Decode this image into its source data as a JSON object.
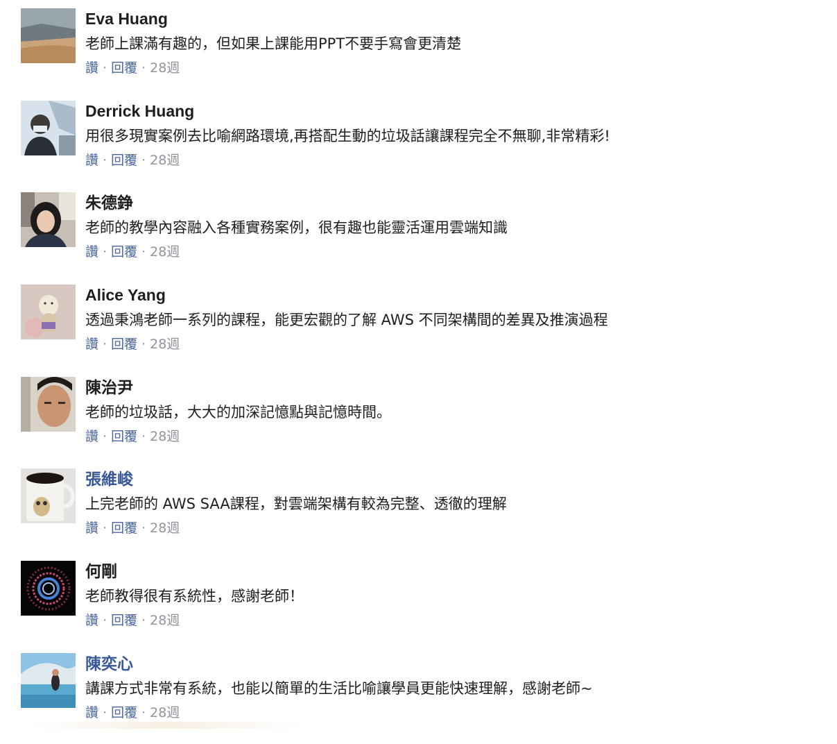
{
  "comments": [
    {
      "name": "Eva Huang",
      "text": "老師上課滿有趣的，但如果上課能用PPT不要手寫會更清楚",
      "like": "讚",
      "reply": "回覆",
      "sep": "·",
      "time": "28週",
      "name_is_link": false,
      "avatar_icon": "avatar-photo-beach"
    },
    {
      "name": "Derrick Huang",
      "text": "用很多現實案例去比喻網路環境,再搭配生動的垃圾話讓課程完全不無聊,非常精彩!",
      "like": "讚",
      "reply": "回覆",
      "sep": "·",
      "time": "28週",
      "name_is_link": false,
      "avatar_icon": "avatar-photo-selfie-mask"
    },
    {
      "name": "朱德錚",
      "text": "老師的教學內容融入各種實務案例，很有趣也能靈活運用雲端知識",
      "like": "讚",
      "reply": "回覆",
      "sep": "·",
      "time": "28週",
      "name_is_link": false,
      "avatar_icon": "avatar-photo-woman"
    },
    {
      "name": "Alice Yang",
      "text": "透過秉鴻老師一系列的課程，能更宏觀的了解 AWS 不同架構間的差異及推演過程",
      "like": "讚",
      "reply": "回覆",
      "sep": "·",
      "time": "28週",
      "name_is_link": false,
      "avatar_icon": "avatar-photo-toy"
    },
    {
      "name": "陳治尹",
      "text": "老師的垃圾話，大大的加深記憶點與記憶時間。",
      "like": "讚",
      "reply": "回覆",
      "sep": "·",
      "time": "28週",
      "name_is_link": false,
      "avatar_icon": "avatar-photo-man"
    },
    {
      "name": "張維峻",
      "text": "上完老師的 AWS SAA課程，對雲端架構有較為完整、透徹的理解",
      "like": "讚",
      "reply": "回覆",
      "sep": "·",
      "time": "28週",
      "name_is_link": true,
      "avatar_icon": "avatar-photo-coffee-mug"
    },
    {
      "name": "何剛",
      "text": "老師教得很有系統性，感謝老師！",
      "like": "讚",
      "reply": "回覆",
      "sep": "·",
      "time": "28週",
      "name_is_link": false,
      "avatar_icon": "avatar-photo-spiral"
    },
    {
      "name": "陳奕心",
      "text": "講課方式非常有系統，也能以簡單的生活比喻讓學員更能快速理解，感謝老師~",
      "like": "讚",
      "reply": "回覆",
      "sep": "·",
      "time": "28週",
      "name_is_link": true,
      "avatar_icon": "avatar-photo-pool"
    }
  ],
  "colors": {
    "name": "#1c1e21",
    "name_link": "#385898",
    "action_link": "#4b67a1",
    "meta": "#90949c"
  }
}
